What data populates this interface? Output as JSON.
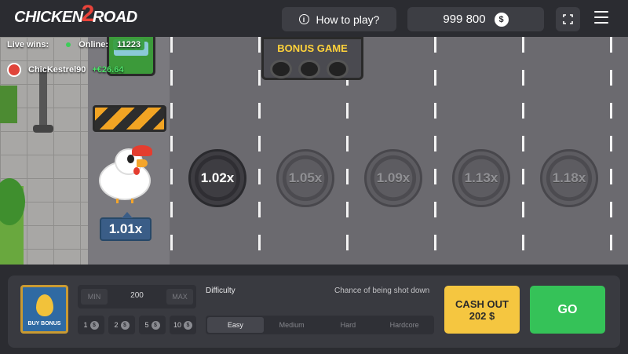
{
  "header": {
    "logo_part1": "CHICKEN",
    "logo_part2": "2",
    "logo_part3": "ROAD",
    "how_to_play": "How to play?",
    "balance": "999 800",
    "currency_icon": "$"
  },
  "live": {
    "live_wins_label": "Live wins:",
    "online_label": "Online:",
    "online_count": "11223",
    "winner_name": "ChicKestrel90",
    "winner_amount": "+€26.64"
  },
  "scene": {
    "bonus_sign": "BONUS GAME",
    "current_multiplier": "1.01x",
    "multipliers": [
      "1.02x",
      "1.05x",
      "1.09x",
      "1.13x",
      "1.18x"
    ]
  },
  "controls": {
    "buy_bonus": "BUY BONUS",
    "min": "MIN",
    "max": "MAX",
    "bet_value": "200",
    "chips": [
      "1",
      "2",
      "5",
      "10"
    ],
    "chip_icon": "$",
    "difficulty_label": "Difficulty",
    "chance_label": "Chance of being shot down",
    "difficulties": [
      "Easy",
      "Medium",
      "Hard",
      "Hardcore"
    ],
    "selected_difficulty": "Easy",
    "cashout_label": "CASH OUT",
    "cashout_amount": "202 $",
    "go_label": "GO"
  },
  "colors": {
    "accent_go": "#35c258",
    "accent_cashout": "#f5c640",
    "road": "#6b6a6f"
  }
}
